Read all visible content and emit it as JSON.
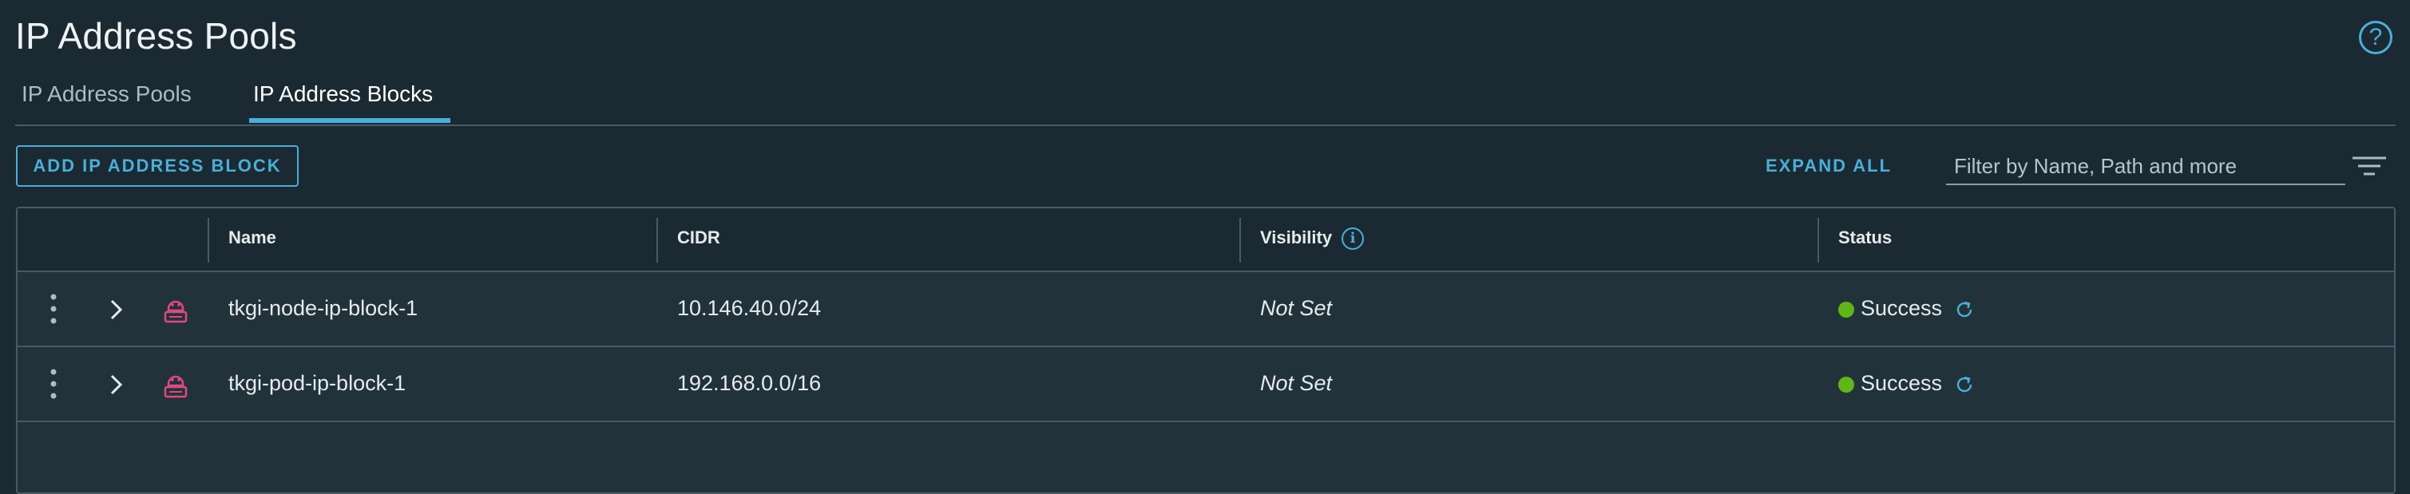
{
  "page": {
    "title": "IP Address Pools",
    "help_icon": "question-circle-icon"
  },
  "tabs": [
    {
      "label": "IP Address Pools",
      "active": false
    },
    {
      "label": "IP Address Blocks",
      "active": true
    }
  ],
  "toolbar": {
    "add_button": "ADD IP ADDRESS BLOCK",
    "expand_all": "EXPAND ALL",
    "filter_placeholder": "Filter by Name, Path and more"
  },
  "table": {
    "columns": {
      "name": "Name",
      "cidr": "CIDR",
      "visibility": "Visibility",
      "status": "Status"
    },
    "rows": [
      {
        "name": "tkgi-node-ip-block-1",
        "cidr": "10.146.40.0/24",
        "visibility": "Not Set",
        "status": "Success"
      },
      {
        "name": "tkgi-pod-ip-block-1",
        "cidr": "192.168.0.0/16",
        "visibility": "Not Set",
        "status": "Success"
      }
    ]
  },
  "colors": {
    "accent": "#49afd9",
    "success": "#5eb715",
    "block_icon": "#e0487e",
    "background": "#1b2a32"
  }
}
